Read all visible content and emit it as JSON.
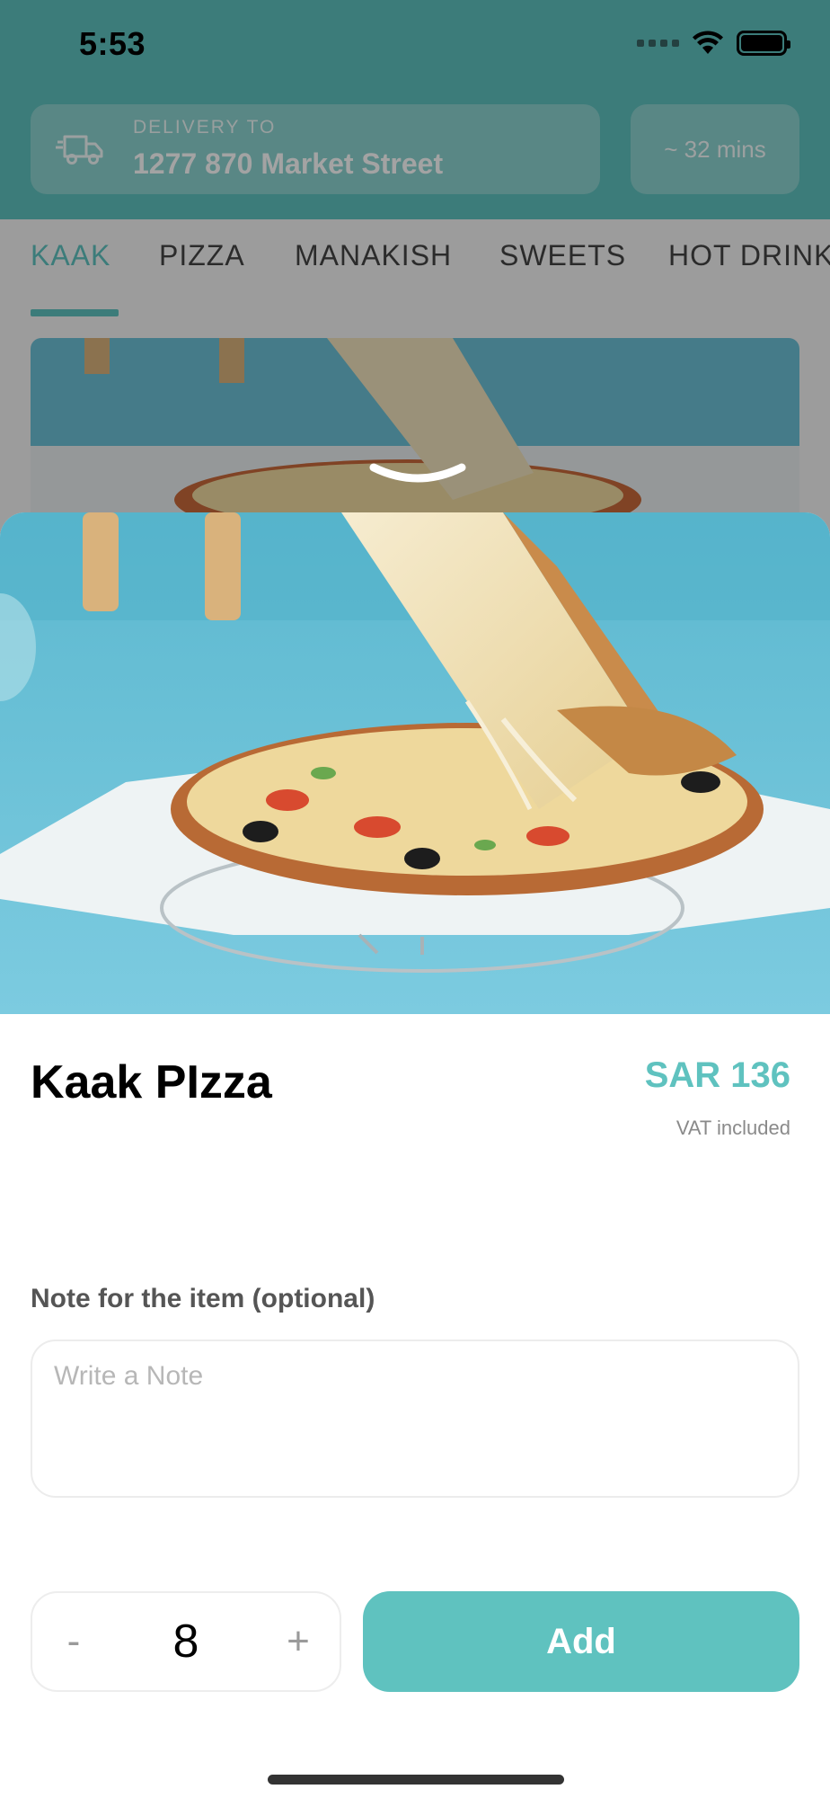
{
  "status_bar": {
    "time": "5:53"
  },
  "header": {
    "delivery_label": "DELIVERY TO",
    "delivery_address": "1277 870 Market Street",
    "eta": "~ 32 mins"
  },
  "category_tabs": [
    {
      "label": "KAAK",
      "active": true
    },
    {
      "label": "PIZZA",
      "active": false
    },
    {
      "label": "MANAKISH",
      "active": false
    },
    {
      "label": "SWEETS",
      "active": false
    },
    {
      "label": "HOT DRINK",
      "active": false
    }
  ],
  "item": {
    "name": "Kaak PIzza",
    "price": "SAR 136",
    "vat_note": "VAT included",
    "image": "pizza-cheese-pull-photo"
  },
  "note": {
    "label": "Note for the item (optional)",
    "placeholder": "Write a Note",
    "value": ""
  },
  "quantity": {
    "minus": "-",
    "value": "8",
    "plus": "+"
  },
  "add_button": {
    "label": "Add"
  },
  "colors": {
    "accent": "#5fc2bf",
    "header_band": "#5fc2bf",
    "muted_text": "#8a8a8a"
  }
}
